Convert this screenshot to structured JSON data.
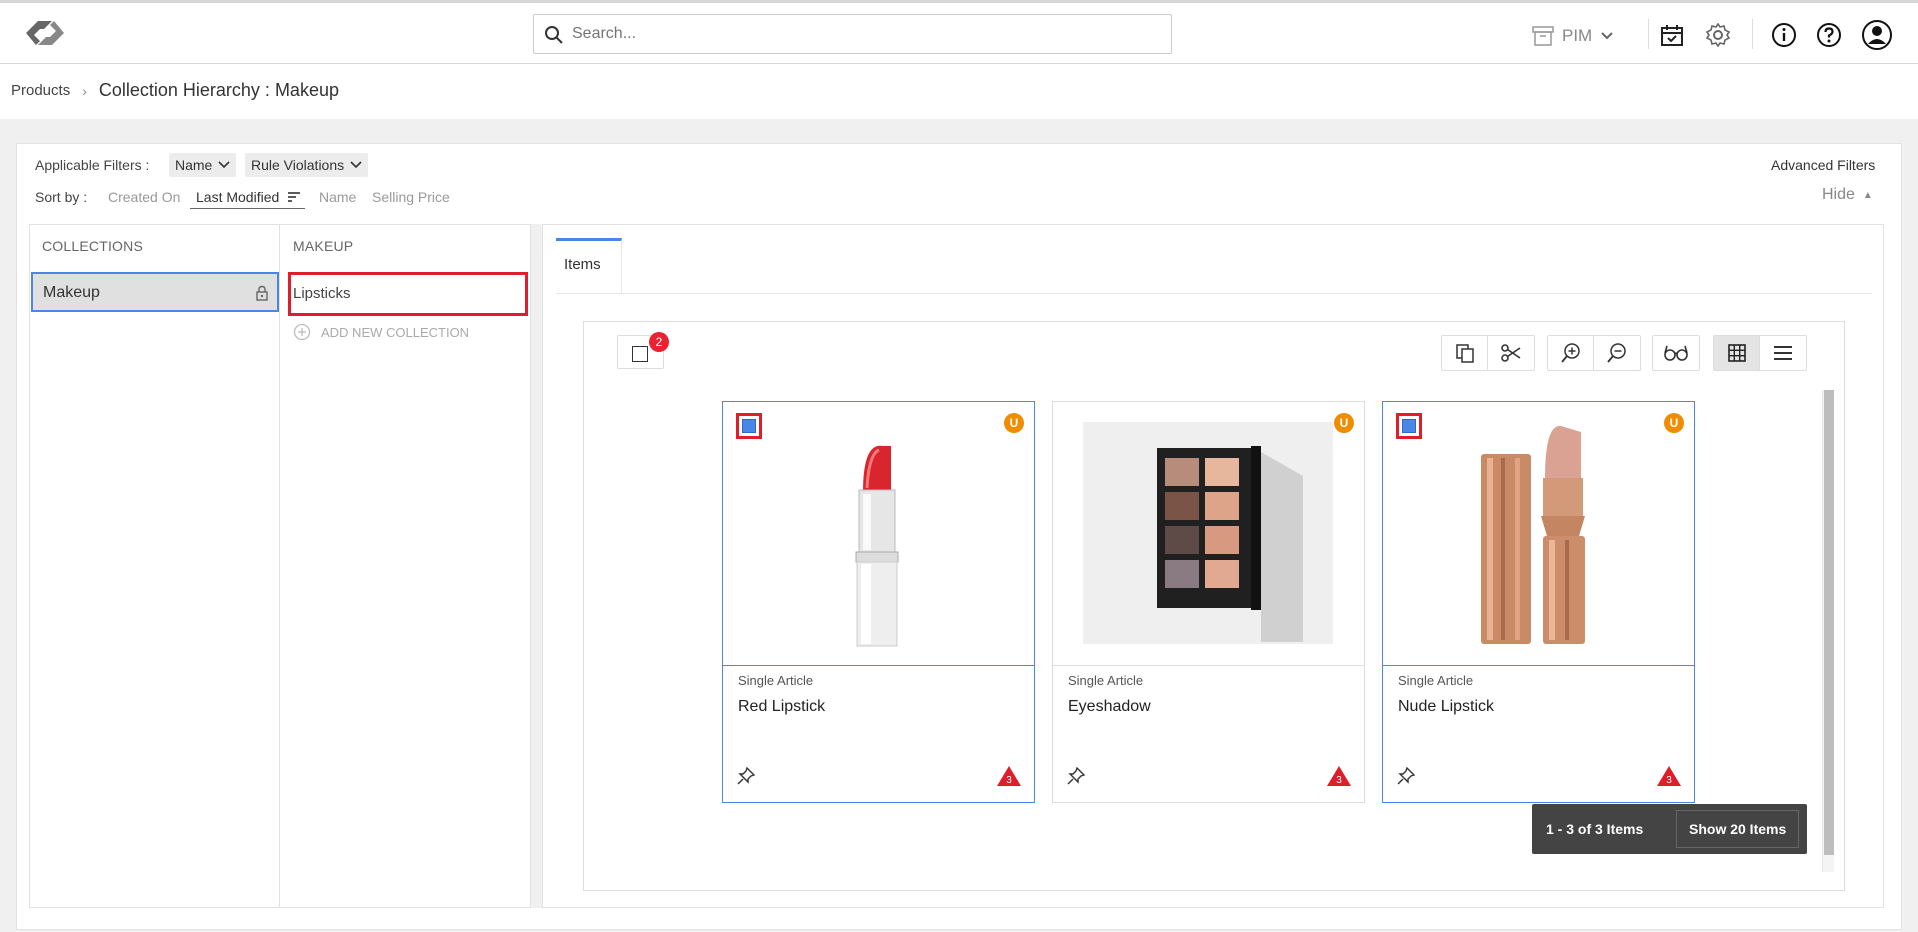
{
  "header": {
    "search_placeholder": "Search...",
    "module_label": "PIM"
  },
  "breadcrumb": {
    "root": "Products",
    "current": "Collection Hierarchy : Makeup"
  },
  "filters": {
    "applicable_label": "Applicable Filters :",
    "chips": [
      "Name",
      "Rule Violations"
    ],
    "advanced_label": "Advanced Filters",
    "hide_label": "Hide",
    "sort_label": "Sort by :",
    "sort_options": [
      "Created On",
      "Last Modified",
      "Name",
      "Selling Price"
    ],
    "active_sort": "Last Modified"
  },
  "collections": {
    "header": "COLLECTIONS",
    "items": [
      {
        "label": "Makeup",
        "locked": true
      }
    ]
  },
  "subcollections": {
    "header": "MAKEUP",
    "items": [
      {
        "label": "Lipsticks"
      }
    ],
    "add_label": "ADD NEW COLLECTION"
  },
  "tabs": [
    {
      "label": "Items"
    }
  ],
  "selection": {
    "count": "2"
  },
  "cards": [
    {
      "type": "Single Article",
      "name": "Red Lipstick",
      "badge": "U",
      "warnings": "3",
      "selected": true
    },
    {
      "type": "Single Article",
      "name": "Eyeshadow",
      "badge": "U",
      "warnings": "3",
      "selected": false
    },
    {
      "type": "Single Article",
      "name": "Nude Lipstick",
      "badge": "U",
      "warnings": "3",
      "selected": true
    }
  ],
  "pagination": {
    "range": "1 - 3 of 3 Items",
    "show": "Show 20 Items"
  },
  "colors": {
    "accent": "#4a86e8",
    "highlight_red": "#e01e2b",
    "badge_orange": "#f08c00"
  }
}
